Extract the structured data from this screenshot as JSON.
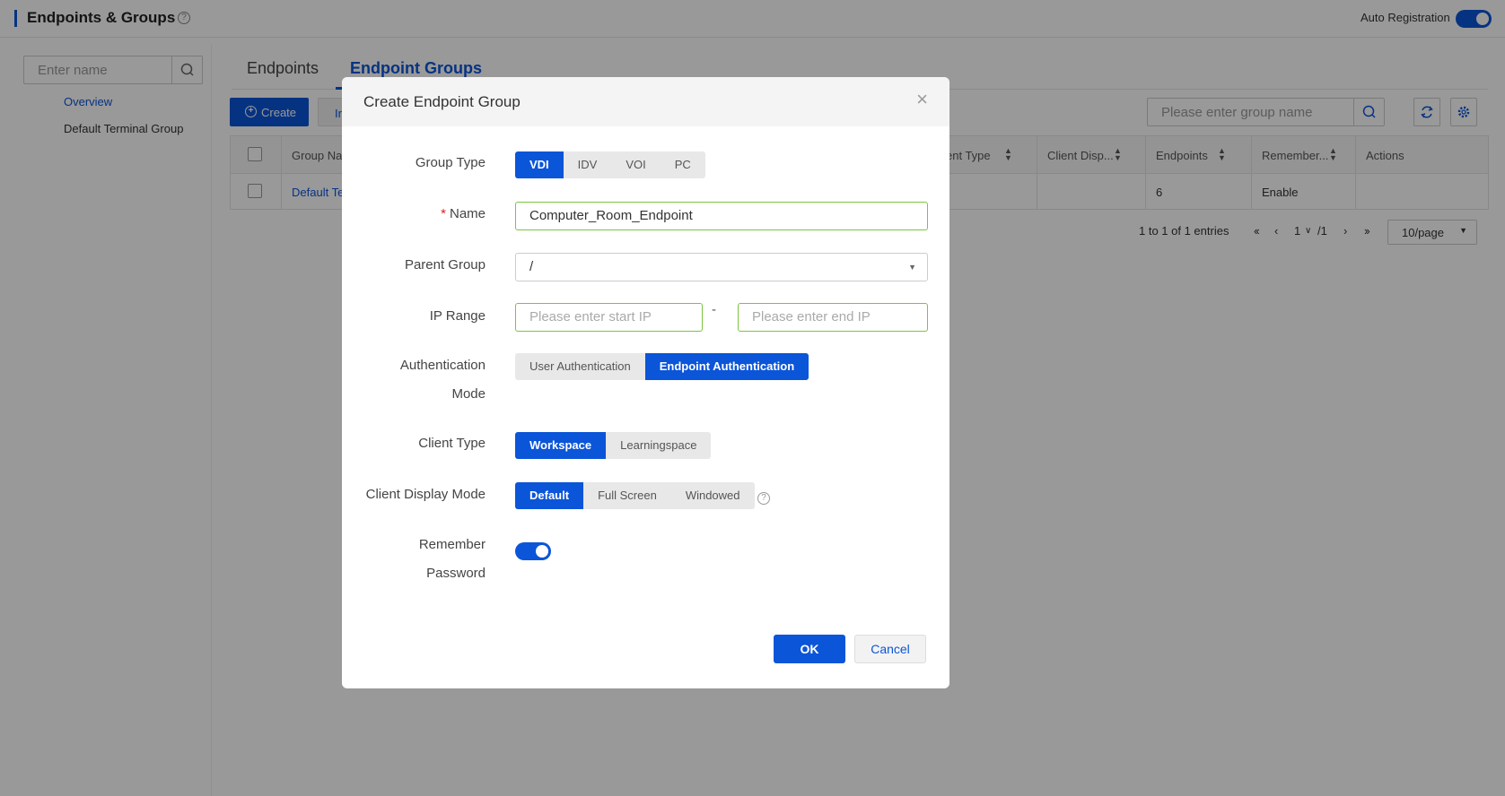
{
  "header": {
    "title": "Endpoints & Groups",
    "auto_registration_label": "Auto Registration",
    "auto_registration_on": true
  },
  "sidebar": {
    "search_placeholder": "Enter name",
    "items": [
      {
        "label": "Overview",
        "active": true
      },
      {
        "label": "Default Terminal Group",
        "active": false
      }
    ]
  },
  "tabs": [
    {
      "label": "Endpoints",
      "active": false
    },
    {
      "label": "Endpoint Groups",
      "active": true
    }
  ],
  "toolbar": {
    "create_label": "Create",
    "import_label": "In",
    "group_search_placeholder": "Please enter group name"
  },
  "table": {
    "columns": [
      "Group Na",
      "ent Type",
      "Client Disp...",
      "Endpoints",
      "Remember...",
      "Actions"
    ],
    "rows": [
      {
        "group_name": "Default Te",
        "endpoints": "6",
        "remember": "Enable"
      }
    ]
  },
  "pagination": {
    "summary": "1 to 1 of 1 entries",
    "current": "1",
    "total": "/1",
    "page_size": "10/page"
  },
  "dialog": {
    "title": "Create Endpoint Group",
    "group_type": {
      "label": "Group Type",
      "options": [
        "VDI",
        "IDV",
        "VOI",
        "PC"
      ],
      "selected": "VDI"
    },
    "name": {
      "label": "Name",
      "value": "Computer_Room_Endpoint"
    },
    "parent_group": {
      "label": "Parent Group",
      "value": "/"
    },
    "ip_range": {
      "label": "IP Range",
      "start_placeholder": "Please enter start IP",
      "separator": "-",
      "end_placeholder": "Please enter end IP"
    },
    "auth_mode": {
      "label_line1": "Authentication",
      "label_line2": "Mode",
      "options": [
        "User Authentication",
        "Endpoint Authentication"
      ],
      "selected": "Endpoint Authentication"
    },
    "client_type": {
      "label": "Client Type",
      "options": [
        "Workspace",
        "Learningspace"
      ],
      "selected": "Workspace"
    },
    "client_display_mode": {
      "label": "Client Display Mode",
      "options": [
        "Default",
        "Full Screen",
        "Windowed"
      ],
      "selected": "Default"
    },
    "remember_password": {
      "label_line1": "Remember",
      "label_line2": "Password",
      "on": true
    },
    "ok_label": "OK",
    "cancel_label": "Cancel"
  },
  "colors": {
    "primary": "#0b55d8",
    "valid_border": "#7cc442",
    "required": "#e02020"
  }
}
